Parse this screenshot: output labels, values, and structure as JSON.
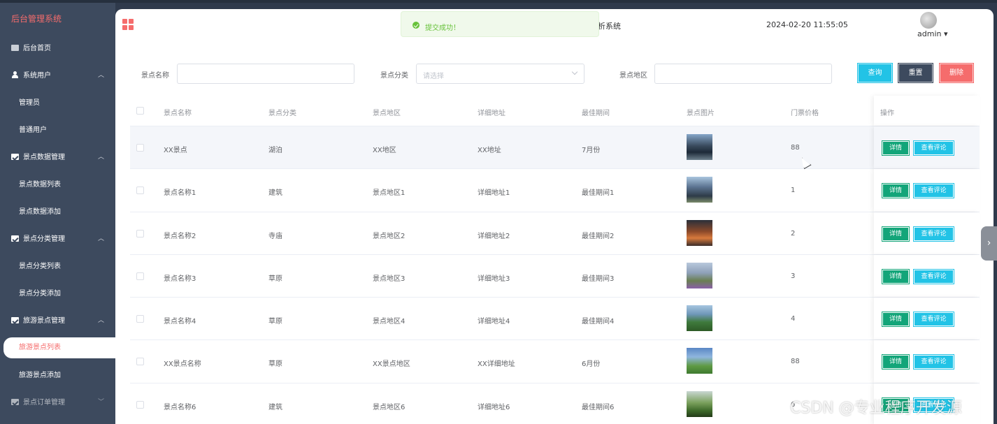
{
  "sidebar": {
    "brand": "后台管理系统",
    "items": [
      {
        "label": "后台首页",
        "icon": "monitor-icon"
      },
      {
        "label": "系统用户",
        "icon": "user-icon",
        "subs": [
          "管理员",
          "普通用户"
        ]
      },
      {
        "label": "景点数据管理",
        "icon": "chart-icon",
        "subs": [
          "景点数据列表",
          "景点数据添加"
        ]
      },
      {
        "label": "景点分类管理",
        "icon": "chart-icon",
        "subs": [
          "景点分类列表",
          "景点分类添加"
        ]
      },
      {
        "label": "旅游景点管理",
        "icon": "chart-icon",
        "subs": [
          "旅游景点列表",
          "旅游景点添加"
        ]
      },
      {
        "label": "景点订单管理",
        "icon": "chart-icon"
      }
    ],
    "active": "旅游景点列表"
  },
  "header": {
    "title_partial": "析系统",
    "datetime": "2024-02-20 11:55:05",
    "user": "admin"
  },
  "toast": {
    "message": "提交成功！"
  },
  "search": {
    "name_label": "景点名称",
    "category_label": "景点分类",
    "category_placeholder": "请选择",
    "region_label": "景点地区",
    "query_button": "查询",
    "reset_button": "重置",
    "delete_button": "删除"
  },
  "table": {
    "headers": [
      "景点名称",
      "景点分类",
      "景点地区",
      "详细地址",
      "最佳期间",
      "景点图片",
      "门票价格",
      "操作"
    ],
    "detail_label": "详情",
    "review_label": "查看评论",
    "rows": [
      {
        "name": "XX景点",
        "category": "湖泊",
        "region": "XX地区",
        "address": "XX地址",
        "period": "7月份",
        "price": "88"
      },
      {
        "name": "景点名称1",
        "category": "建筑",
        "region": "景点地区1",
        "address": "详细地址1",
        "period": "最佳期间1",
        "price": "1"
      },
      {
        "name": "景点名称2",
        "category": "寺庙",
        "region": "景点地区2",
        "address": "详细地址2",
        "period": "最佳期间2",
        "price": "2"
      },
      {
        "name": "景点名称3",
        "category": "草原",
        "region": "景点地区3",
        "address": "详细地址3",
        "period": "最佳期间3",
        "price": "3"
      },
      {
        "name": "景点名称4",
        "category": "草原",
        "region": "景点地区4",
        "address": "详细地址4",
        "period": "最佳期间4",
        "price": "4"
      },
      {
        "name": "XX景点名称",
        "category": "草原",
        "region": "XX景点地区",
        "address": "XX详细地址",
        "period": "6月份",
        "price": "88"
      },
      {
        "name": "景点名称6",
        "category": "建筑",
        "region": "景点地区6",
        "address": "详细地址6",
        "period": "最佳期间6",
        "price": "6"
      }
    ]
  },
  "watermark": "CSDN @专业程序开发源",
  "colors": {
    "sidebar_bg": "#3d4a5e",
    "accent_red": "#f56c6c",
    "accent_cyan": "#22c3e6",
    "accent_green": "#13a579"
  }
}
